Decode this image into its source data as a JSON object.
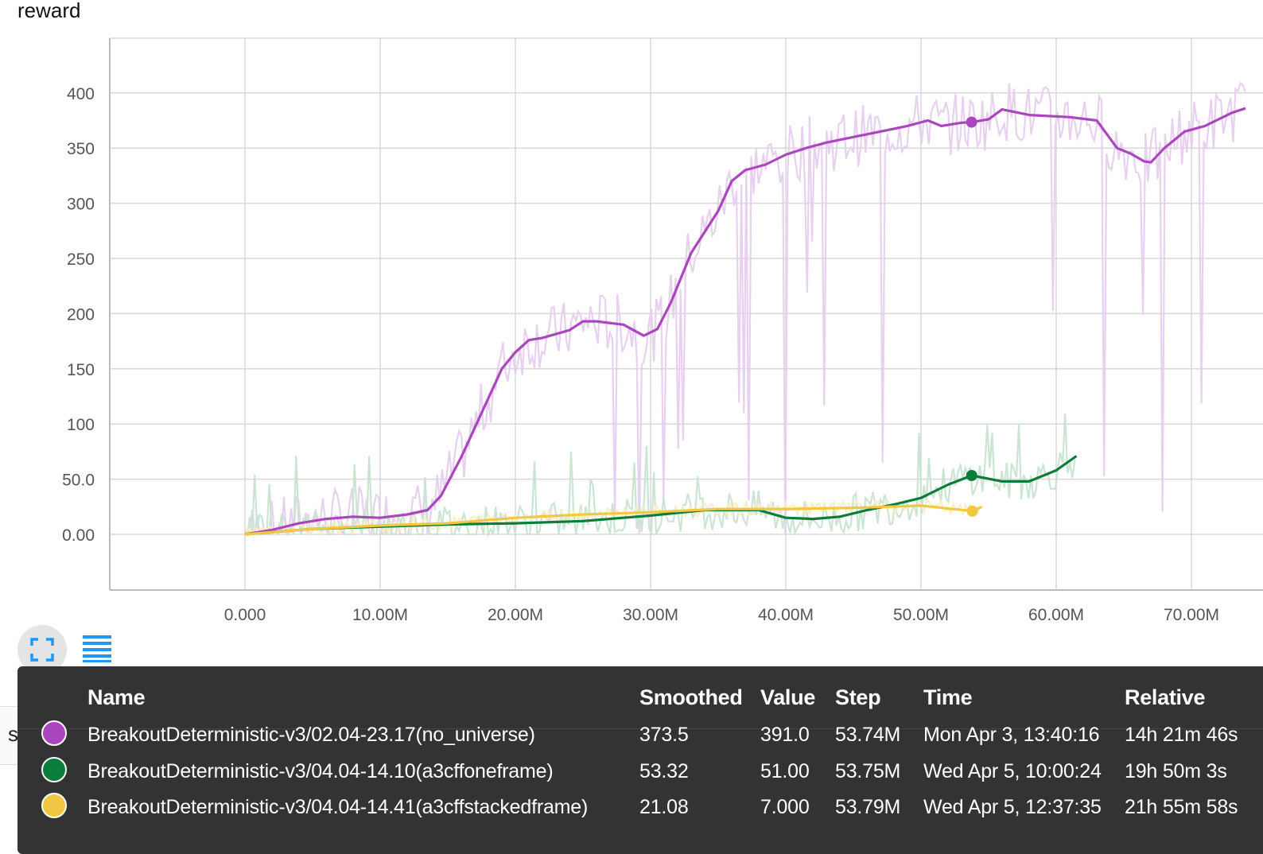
{
  "chart_data": {
    "type": "line",
    "title": "reward",
    "xlabel": "",
    "ylabel": "",
    "xlim": [
      -10000000,
      74000000
    ],
    "ylim": [
      -50,
      450
    ],
    "x_ticks": [
      0,
      10000000,
      20000000,
      30000000,
      40000000,
      50000000,
      60000000,
      70000000
    ],
    "x_tick_labels": [
      "0.000",
      "10.00M",
      "20.00M",
      "30.00M",
      "40.00M",
      "50.00M",
      "60.00M",
      "70.00M"
    ],
    "y_ticks": [
      0,
      50,
      100,
      150,
      200,
      250,
      300,
      350,
      400
    ],
    "y_tick_labels": [
      "0.00",
      "50.0",
      "100",
      "150",
      "200",
      "250",
      "300",
      "350",
      "400"
    ],
    "grid": true,
    "series": [
      {
        "name": "BreakoutDeterministic-v3/02.04-23.17(no_universe)",
        "color": "#ab47bc",
        "raw_color": "#e6cfee",
        "x": [
          0,
          2000000,
          4000000,
          6000000,
          8000000,
          10000000,
          12000000,
          13500000,
          14500000,
          16000000,
          17500000,
          19000000,
          20000000,
          21000000,
          22000000,
          24000000,
          25000000,
          26000000,
          28000000,
          29500000,
          30500000,
          31500000,
          33000000,
          35000000,
          36000000,
          37000000,
          38500000,
          40000000,
          41500000,
          43000000,
          45000000,
          47000000,
          49000000,
          50500000,
          51500000,
          53000000,
          53740000,
          55000000,
          56000000,
          58000000,
          61000000,
          63000000,
          64500000,
          65500000,
          66500000,
          67000000,
          68000000,
          69500000,
          71000000,
          73000000,
          74000000
        ],
        "values": [
          0,
          4,
          10,
          14,
          16,
          15,
          18,
          22,
          35,
          70,
          110,
          150,
          165,
          176,
          178,
          185,
          193,
          193,
          190,
          180,
          186,
          210,
          255,
          293,
          320,
          330,
          335,
          344,
          350,
          355,
          360,
          365,
          370,
          375,
          370,
          373,
          373.5,
          376,
          385,
          380,
          378,
          375,
          350,
          345,
          338,
          337,
          350,
          365,
          370,
          382,
          386
        ]
      },
      {
        "name": "BreakoutDeterministic-v3/04.04-14.10(a3cffoneframe)",
        "color": "#0a7d3b",
        "raw_color": "#c8e4d0",
        "x": [
          0,
          5000000,
          10000000,
          15000000,
          20000000,
          25000000,
          30000000,
          34000000,
          38000000,
          40000000,
          42000000,
          44000000,
          46000000,
          48000000,
          50000000,
          52000000,
          53750000,
          56000000,
          58000000,
          60000000,
          61500000
        ],
        "values": [
          0,
          5,
          7,
          9,
          10,
          12,
          17,
          22,
          22,
          15,
          14,
          16,
          22,
          27,
          33,
          45,
          53.32,
          48,
          48,
          58,
          71
        ]
      },
      {
        "name": "BreakoutDeterministic-v3/04.04-14.41(a3cffstackedframe)",
        "color": "#f2c744",
        "raw_color": "#faeec3",
        "x": [
          0,
          5000000,
          10000000,
          15000000,
          20000000,
          25000000,
          30000000,
          35000000,
          40000000,
          45000000,
          50000000,
          53790000,
          54500000
        ],
        "values": [
          0,
          5,
          8,
          10,
          15,
          18,
          20,
          23,
          23,
          24,
          26,
          21.08,
          25
        ]
      }
    ]
  },
  "toolbar": {
    "expand_icon": "fullscreen-icon",
    "list_icon": "list-icon"
  },
  "below_label": "step_s",
  "tooltip": {
    "headers": {
      "name": "Name",
      "smoothed": "Smoothed",
      "value": "Value",
      "step": "Step",
      "time": "Time",
      "relative": "Relative"
    },
    "rows": [
      {
        "color": "#ab47bc",
        "name": "BreakoutDeterministic-v3/02.04-23.17(no_universe)",
        "smoothed": "373.5",
        "value": "391.0",
        "step": "53.74M",
        "time": "Mon Apr 3, 13:40:16",
        "relative": "14h 21m 46s"
      },
      {
        "color": "#0a7d3b",
        "name": "BreakoutDeterministic-v3/04.04-14.10(a3cffoneframe)",
        "smoothed": "53.32",
        "value": "51.00",
        "step": "53.75M",
        "time": "Wed Apr 5, 10:00:24",
        "relative": "19h 50m 3s"
      },
      {
        "color": "#f2c744",
        "name": "BreakoutDeterministic-v3/04.04-14.41(a3cffstackedframe)",
        "smoothed": "21.08",
        "value": "7.000",
        "step": "53.79M",
        "time": "Wed Apr 5, 12:37:35",
        "relative": "21h 55m 58s"
      }
    ]
  }
}
